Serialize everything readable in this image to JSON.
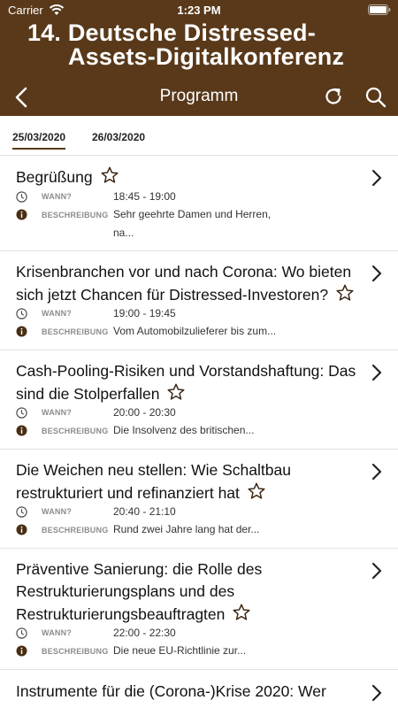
{
  "status_bar": {
    "carrier": "Carrier",
    "time": "1:23 PM"
  },
  "conference": {
    "title_line1": "14. Deutsche Distressed-",
    "title_line2": "Assets-Digitalkonferenz"
  },
  "nav": {
    "title": "Programm"
  },
  "date_tabs": [
    {
      "label": "25/03/2020",
      "active": true
    },
    {
      "label": "26/03/2020",
      "active": false
    }
  ],
  "labels": {
    "when": "WANN?",
    "description": "BESCHREIBUNG"
  },
  "sessions": [
    {
      "title": "Begrüßung",
      "time": "18:45 - 19:00",
      "description": "Sehr geehrte Damen und Herren, na..."
    },
    {
      "title": "Krisenbranchen vor und nach Corona: Wo bieten sich jetzt Chancen für Distressed-Investoren?",
      "time": "19:00 - 19:45",
      "description": "Vom Automobilzulieferer bis zum..."
    },
    {
      "title": "Cash-Pooling-Risiken und Vorstandshaftung: Das sind die Stolperfallen",
      "time": "20:00 - 20:30",
      "description": "Die Insolvenz des britischen..."
    },
    {
      "title": "Die Weichen neu stellen: Wie Schaltbau restrukturiert und refinanziert hat",
      "time": "20:40 - 21:10",
      "description": "Rund zwei Jahre lang hat der..."
    },
    {
      "title": "Präventive Sanierung: die Rolle des Restrukturierungsplans und des Restrukturierungsbeauftragten",
      "time": "22:00 - 22:30",
      "description": "Die neue EU-Richtlinie zur..."
    },
    {
      "title": "Instrumente für die (Corona-)Krise 2020: Wer"
    }
  ],
  "colors": {
    "header_bg": "#59391a",
    "accent": "#59391a",
    "label_gray": "#8c8c8c"
  },
  "icons": [
    "wifi-icon",
    "battery-icon",
    "back-chevron-icon",
    "refresh-icon",
    "search-icon",
    "star-outline-icon",
    "clock-icon",
    "info-icon",
    "chevron-right-icon"
  ]
}
